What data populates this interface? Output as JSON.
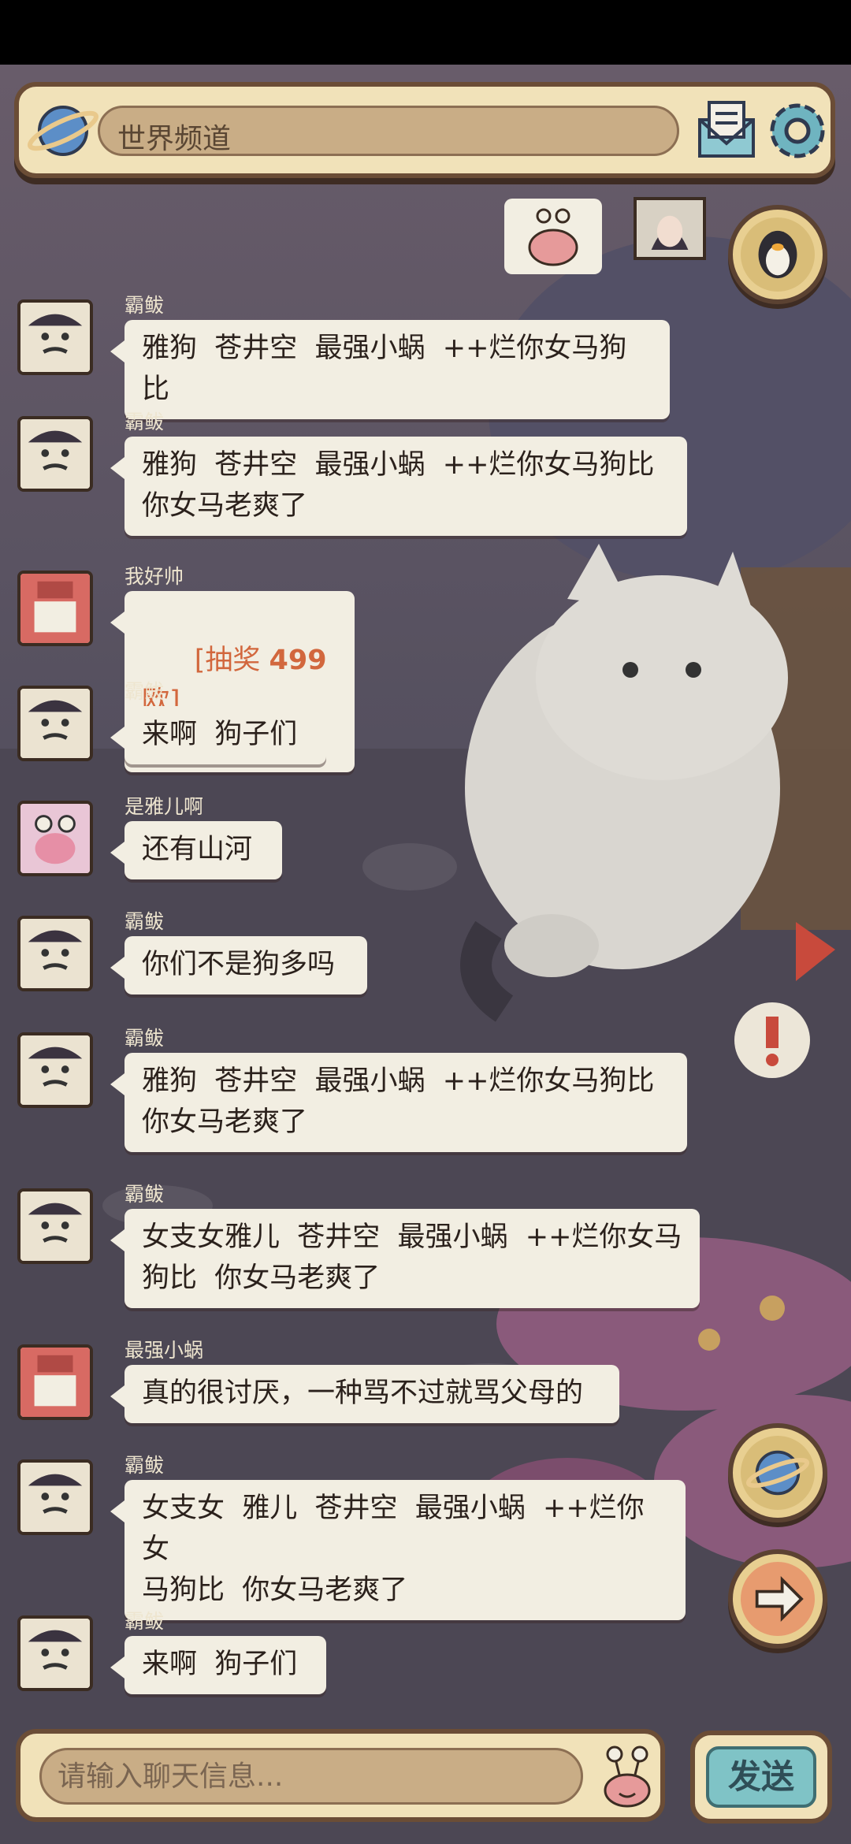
{
  "header": {
    "channel_title": "世界频道"
  },
  "messages": [
    {
      "user": "霸鲅",
      "text": "雅狗  苍井空  最强小蜗  ++烂你女马狗比"
    },
    {
      "user": "霸鲅",
      "text": "雅狗  苍井空  最强小蜗  ++烂你女马狗比\n你女马老爽了"
    },
    {
      "user": "我好帅",
      "lottery_prefix": "[抽奖 ",
      "lottery_amount": "499",
      "lottery_suffix": " 欧]"
    },
    {
      "user": "霸鲅",
      "text": "来啊  狗子们"
    },
    {
      "user": "是雅儿啊",
      "text": "还有山河"
    },
    {
      "user": "霸鲅",
      "text": "你们不是狗多吗"
    },
    {
      "user": "霸鲅",
      "text": "雅狗  苍井空  最强小蜗  ++烂你女马狗比\n你女马老爽了"
    },
    {
      "user": "霸鲅",
      "text": "女支女雅儿  苍井空  最强小蜗  ++烂你女马\n狗比  你女马老爽了"
    },
    {
      "user": "最强小蜗",
      "text": "真的很讨厌，一种骂不过就骂父母的"
    },
    {
      "user": "霸鲅",
      "text": "女支女  雅儿  苍井空  最强小蜗  ++烂你女\n马狗比  你女马老爽了"
    },
    {
      "user": "霸鲅",
      "text": "来啊  狗子们"
    }
  ],
  "input": {
    "placeholder": "请输入聊天信息..."
  },
  "send_button": {
    "label": "发送"
  }
}
